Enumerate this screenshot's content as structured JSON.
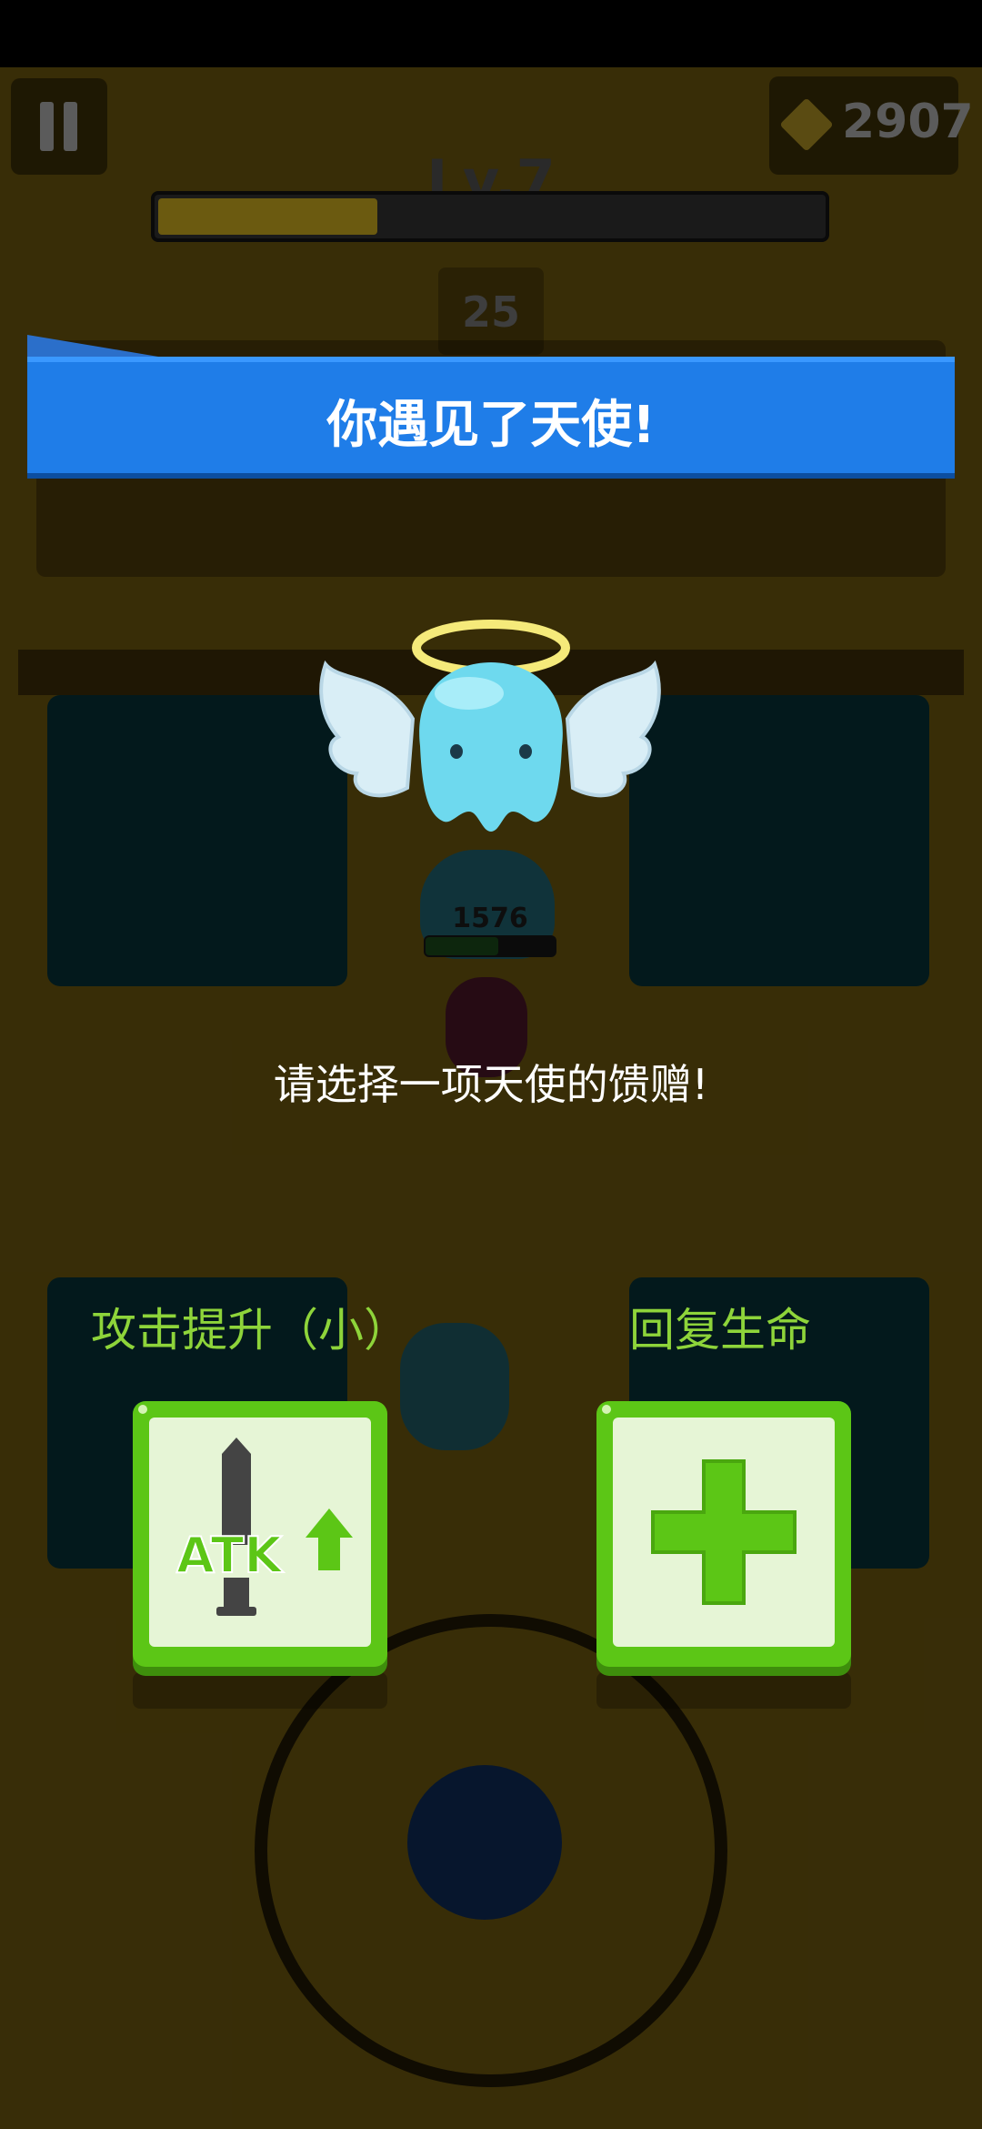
{
  "hud": {
    "level": "Lv.7",
    "coins": "2907",
    "wave": "25",
    "xp_progress": 0.33
  },
  "banner": {
    "title": "你遇见了天使!"
  },
  "prompt": "请选择一项天使的馈赠!",
  "enemy_hp": "1576",
  "options": [
    {
      "label": "攻击提升（小）",
      "icon": "atk-up-sword-icon",
      "icon_text": "ATK"
    },
    {
      "label": "回复生命",
      "icon": "heal-plus-icon"
    }
  ],
  "colors": {
    "banner": "#1f7de8",
    "option_label": "#8ed43a",
    "card_green": "#5cc616",
    "card_inner": "#e6f5d6",
    "angel_body": "#6ed9ee",
    "halo": "#f5ea7a"
  }
}
